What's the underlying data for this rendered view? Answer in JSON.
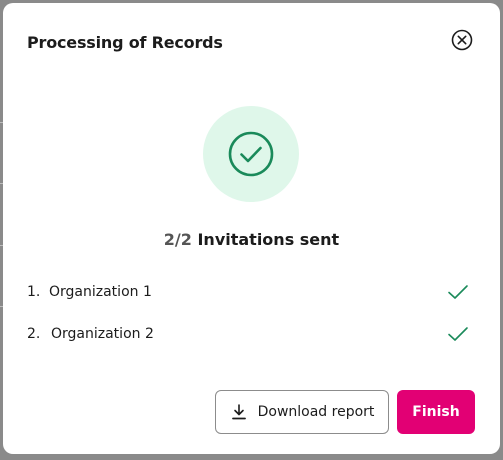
{
  "dialog": {
    "title": "Processing of Records",
    "close_icon": "close-circle-icon",
    "success_icon": "check-circle-icon"
  },
  "status": {
    "count": "2/2",
    "text": "Invitations sent"
  },
  "organizations": [
    {
      "number": "1.",
      "name": "Organization 1",
      "icon": "check-icon"
    },
    {
      "number": "2.",
      "name": "Organization 2",
      "icon": "check-icon"
    }
  ],
  "actions": {
    "download_label": "Download report",
    "download_icon": "download-icon",
    "finish_label": "Finish"
  },
  "colors": {
    "accent": "#e20074",
    "success": "#1a8a5a",
    "success_bg": "#dff7ea"
  }
}
